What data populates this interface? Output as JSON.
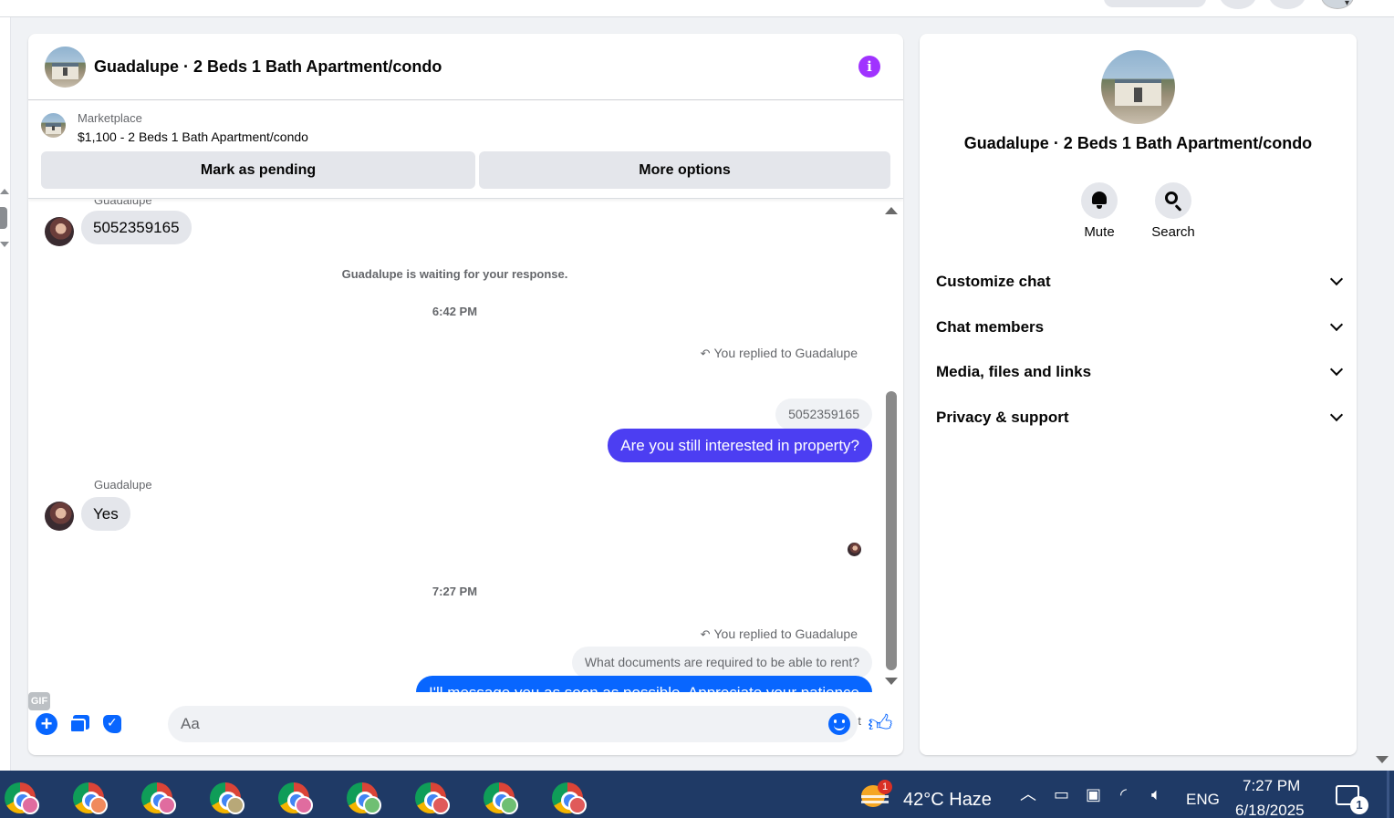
{
  "conversation": {
    "title": "Guadalupe · 2 Beds 1 Bath Apartment/condo"
  },
  "marketplace": {
    "label": "Marketplace",
    "item": "$1,100 - 2 Beds 1 Bath Apartment/condo",
    "mark_pending": "Mark as pending",
    "more_options": "More options"
  },
  "messages": {
    "sender_top_partial": "Guadalupe",
    "phone_msg": "5052359165",
    "waiting_notice": "Guadalupe is waiting for your response.",
    "time1": "6:42 PM",
    "reply1_label": "You replied to Guadalupe",
    "reply1_quote": "5052359165",
    "reply1_text": "Are you still interested in property?",
    "sender_name": "Guadalupe",
    "yes_msg": "Yes",
    "time2": "7:27 PM",
    "reply2_label": "You replied to Guadalupe",
    "reply2_quote": "What documents are required to be able to rent?",
    "reply2_text": "I'll message you as soon as possible. Appreciate your patience",
    "sent_status": "Sent"
  },
  "composer": {
    "placeholder": "Aa",
    "gif_label": "GIF"
  },
  "info_panel": {
    "title": "Guadalupe · 2 Beds 1 Bath Apartment/condo",
    "mute": "Mute",
    "search": "Search",
    "sections": [
      "Customize chat",
      "Chat members",
      "Media, files and links",
      "Privacy & support"
    ]
  },
  "taskbar": {
    "apps": [
      {
        "icon": "chrome-icon",
        "profile_color": "#e06c9f"
      },
      {
        "icon": "chrome-icon",
        "profile_color": "#f08a5d"
      },
      {
        "icon": "chrome-icon",
        "profile_color": "#e06c9f"
      },
      {
        "icon": "chrome-icon",
        "profile_color": "#b8a878"
      },
      {
        "icon": "chrome-icon",
        "profile_color": "#e06c9f"
      },
      {
        "icon": "chrome-icon",
        "profile_color": "#6fbf73"
      },
      {
        "icon": "chrome-icon",
        "profile_color": "#e05a5a"
      },
      {
        "icon": "chrome-icon",
        "profile_color": "#6fbf73"
      },
      {
        "icon": "chrome-icon",
        "profile_color": "#e05a5a"
      }
    ],
    "weather_badge": "1",
    "weather": "42°C  Haze",
    "language": "ENG",
    "time": "7:27 PM",
    "date": "6/18/2025",
    "notification_count": "1"
  },
  "colors": {
    "accent_purple": "#a033ff",
    "bubble_purple": "#4c3ef2",
    "bubble_blue": "#0866ff",
    "taskbar": "#1f3a66"
  }
}
